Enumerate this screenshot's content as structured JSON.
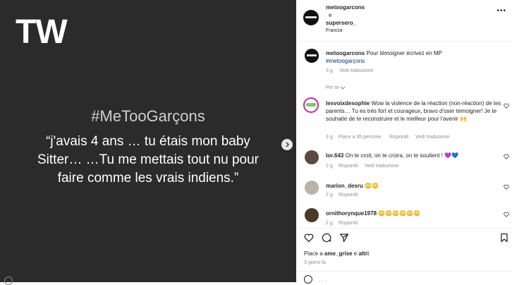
{
  "post": {
    "logo": "TW",
    "hashtag": "#MeTooGarçons",
    "quote": "“j'avais 4 ans … tu étais mon baby Sitter… …Tu me mettais tout nu pour faire comme les vrais indiens.”"
  },
  "header": {
    "user1": "metoogarcons",
    "joiner": "e",
    "user2": "supersero_",
    "location": "Francia"
  },
  "caption": {
    "username": "metoogarcons",
    "text": "Pour témoigner écrivez en MP",
    "hashtag": "#metoogarçons",
    "time": "3 g",
    "translate": "Vedi traduzione",
    "see_translation_label": "Per te"
  },
  "comments": [
    {
      "username": "lesvoixdesophie",
      "text": "Wow la violence de la réaction (non-réaction) de tes parents… Tu es très fort et courageux, bravo d'oser témoigner! Je te souhaite de te reconstruire et le meilleur pour l'avenir 🙌",
      "time": "3 g",
      "likes": "Piace a 35 persone",
      "reply": "Rispondi",
      "translate": "Vedi traduzione"
    },
    {
      "username": "lor.643",
      "text": "On te croit, on te croira, on te soutient ! 💜💙",
      "time": "2 g",
      "reply": "Rispondi",
      "translate": "Vedi traduzione"
    },
    {
      "username": "marion_desru",
      "text": "😳😳",
      "time": "2 g",
      "reply": "Rispondi"
    },
    {
      "username": "ornithorynque1978",
      "text": "😳😳😳😳😳😳",
      "time": "2 g",
      "reply": "Rispondi"
    }
  ],
  "actions": {
    "liked_by_prefix": "Piace a",
    "liked_by_user": "ame_grise",
    "liked_by_joiner": "e",
    "liked_by_others": "altri",
    "date": "3 giorni fa"
  },
  "icons": [
    "heart-icon",
    "comment-icon",
    "share-icon",
    "bookmark-icon",
    "chevron-right-icon"
  ],
  "colors": {
    "post_bg": "#2b2b2b",
    "link": "#00376b",
    "muted": "#8e8e8e"
  }
}
